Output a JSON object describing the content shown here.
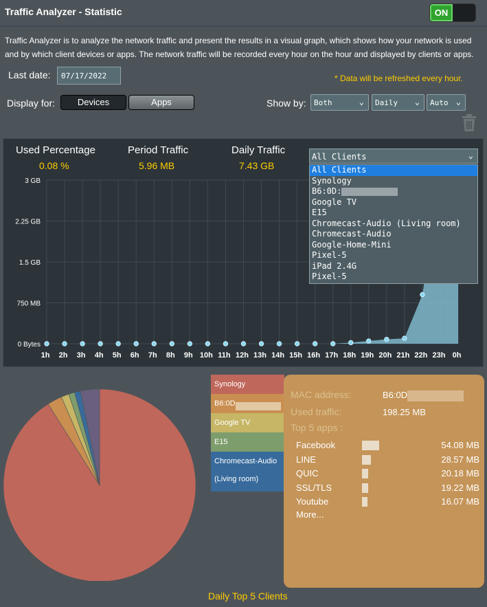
{
  "header": {
    "title": "Traffic Analyzer - Statistic",
    "toggle_label": "ON"
  },
  "description": "Traffic Analyzer is to analyze the network traffic and present the results in a visual graph, which shows how your network is used and by which client devices or apps. The network traffic will be recorded every hour on the hour and displayed by clients or apps.",
  "last_date": {
    "label": "Last date:",
    "value": "07/17/2022"
  },
  "refresh_note": "* Data will be refreshed every hour.",
  "display_for": {
    "label": "Display for:",
    "devices": "Devices",
    "apps": "Apps"
  },
  "show_by": {
    "label": "Show by:",
    "direction": "Both",
    "period": "Daily",
    "unit": "Auto"
  },
  "stats": {
    "used_percentage": {
      "label": "Used Percentage",
      "value": "0.08 %"
    },
    "period_traffic": {
      "label": "Period Traffic",
      "value": "5.96 MB"
    },
    "daily_traffic": {
      "label": "Daily Traffic",
      "value": "7.43 GB"
    }
  },
  "client_filter": {
    "selected": "All Clients",
    "options": [
      "All Clients",
      "Synology",
      "B6:0D:",
      "Google TV",
      "E15",
      "Chromecast-Audio (Living room)",
      "Chromecast-Audio",
      "Google-Home-Mini",
      "Pixel-5",
      "iPad 2.4G",
      "Pixel-5"
    ]
  },
  "chart_data": [
    {
      "type": "area",
      "x": [
        "1h",
        "2h",
        "3h",
        "4h",
        "5h",
        "6h",
        "7h",
        "8h",
        "9h",
        "10h",
        "11h",
        "12h",
        "13h",
        "14h",
        "15h",
        "16h",
        "17h",
        "18h",
        "19h",
        "20h",
        "21h",
        "22h",
        "23h",
        "0h"
      ],
      "ytick_labels": [
        "3 GB",
        "2.25 GB",
        "1.5 GB",
        "750 MB",
        "0 Bytes"
      ],
      "ylim_gb": [
        0,
        3
      ],
      "values_gb": [
        0,
        0,
        0,
        0,
        0,
        0,
        0,
        0,
        0,
        0,
        0,
        0,
        0,
        0,
        0,
        0,
        0,
        0.02,
        0.05,
        0.08,
        0.1,
        0.9,
        3.0,
        3.0
      ],
      "grid": true
    },
    {
      "type": "pie",
      "title": "Daily Top 5 Clients",
      "categories": [
        "Synology",
        "B6:0D",
        "Google TV",
        "E15",
        "Chromecast-Audio (Living room)",
        "Other"
      ],
      "values": [
        91,
        2.5,
        1.3,
        1.0,
        1.0,
        3.2
      ],
      "colors": [
        "#c0675b",
        "#c98e50",
        "#c6b665",
        "#7e9d6c",
        "#386b9c",
        "#6a5f7e"
      ]
    }
  ],
  "legend": [
    {
      "label": "Synology",
      "color": "#c0675b"
    },
    {
      "label": "B6:0D",
      "color": "#c98e50"
    },
    {
      "label": "Google TV",
      "color": "#c6b665"
    },
    {
      "label": "E15",
      "color": "#7e9d6c"
    },
    {
      "label": "Chromecast-Audio",
      "label2": "(Living room)",
      "color": "#386b9c"
    }
  ],
  "info_card": {
    "mac_label": "MAC address:",
    "mac_value": "B6:0D",
    "traffic_label": "Used traffic:",
    "traffic_value": "198.25 MB",
    "top_apps_label": "Top 5 apps :",
    "apps": [
      {
        "name": "Facebook",
        "value": "54.08 MB",
        "ratio": 1.0
      },
      {
        "name": "LINE",
        "value": "28.57 MB",
        "ratio": 0.53
      },
      {
        "name": "QUIC",
        "value": "20.18 MB",
        "ratio": 0.37
      },
      {
        "name": "SSL/TLS",
        "value": "19.22 MB",
        "ratio": 0.36
      },
      {
        "name": "Youtube",
        "value": "16.07 MB",
        "ratio": 0.3
      }
    ],
    "more": "More..."
  },
  "caption": "Daily Top 5 Clients",
  "icons": {
    "trash": "trash-icon",
    "chevron": "chevron-down-icon"
  }
}
